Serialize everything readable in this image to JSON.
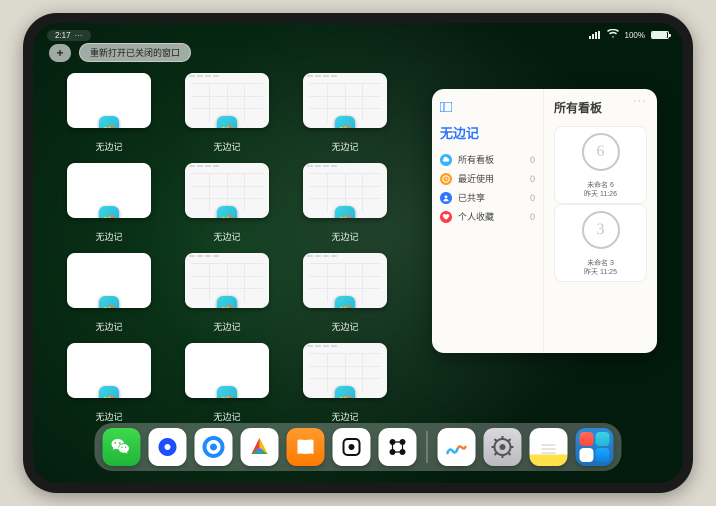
{
  "status": {
    "time": "2:17",
    "battery_pct": "100%"
  },
  "controls": {
    "plus": "+",
    "reopen_label": "重新打开已关闭的窗口"
  },
  "switcher": {
    "app_label": "无边记",
    "windows": [
      {
        "kind": "blank"
      },
      {
        "kind": "grid"
      },
      {
        "kind": "grid"
      },
      {
        "kind": "blank"
      },
      {
        "kind": "grid"
      },
      {
        "kind": "grid"
      },
      {
        "kind": "blank"
      },
      {
        "kind": "grid"
      },
      {
        "kind": "grid"
      },
      {
        "kind": "blank"
      },
      {
        "kind": "blank"
      },
      {
        "kind": "grid"
      }
    ]
  },
  "panel": {
    "title_left": "无边记",
    "title_right": "所有看板",
    "nav": [
      {
        "icon": "cloud",
        "label": "所有看板",
        "count": "0"
      },
      {
        "icon": "clock",
        "label": "最近使用",
        "count": "0"
      },
      {
        "icon": "people",
        "label": "已共享",
        "count": "0"
      },
      {
        "icon": "heart",
        "label": "个人收藏",
        "count": "0"
      }
    ],
    "boards": [
      {
        "glyph": "6",
        "name": "未命名 6",
        "date": "昨天 11:26"
      },
      {
        "glyph": "3",
        "name": "未命名 3",
        "date": "昨天 11:25"
      }
    ]
  },
  "dock": {
    "apps": [
      {
        "id": "wechat",
        "name": "WeChat"
      },
      {
        "id": "blue1",
        "name": "Browser"
      },
      {
        "id": "blue2",
        "name": "QQ Browser"
      },
      {
        "id": "google",
        "name": "Google"
      },
      {
        "id": "books",
        "name": "Books"
      },
      {
        "id": "white1",
        "name": "Dice"
      },
      {
        "id": "white2",
        "name": "Connect"
      },
      {
        "id": "divider",
        "name": ""
      },
      {
        "id": "freeform",
        "name": "Freeform"
      },
      {
        "id": "settings",
        "name": "Settings"
      },
      {
        "id": "notes",
        "name": "Notes"
      },
      {
        "id": "folder",
        "name": "App Folder"
      }
    ]
  }
}
